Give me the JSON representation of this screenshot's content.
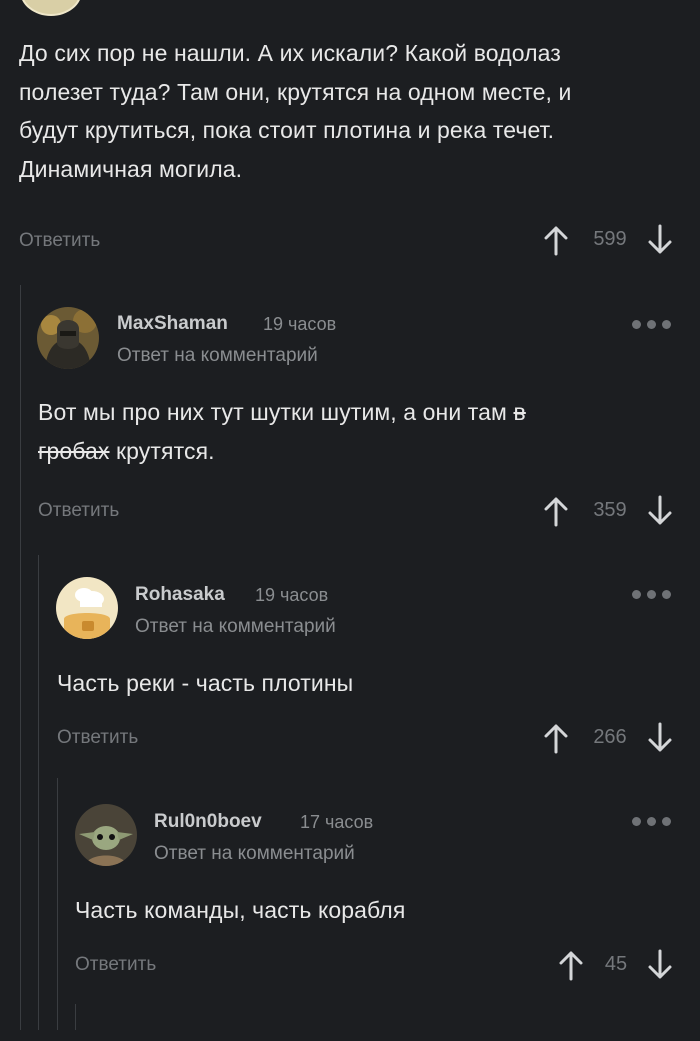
{
  "comments": [
    {
      "text_lines": [
        "До сих пор не нашли. А их искали? Какой водолаз",
        "полезет туда? Там они, крутятся на одном месте, и",
        "будут крутиться, пока стоит плотина и река течет.",
        "Динамичная могила."
      ],
      "reply_label": "Ответить",
      "votes": "599"
    },
    {
      "username": "MaxShaman",
      "time": "19 часов",
      "subline": "Ответ на комментарий",
      "text_line1": "Вот мы про них тут шутки шутим, а они там",
      "text_strike1": "в",
      "text_strike2": "гробах",
      "text_line2_tail": "крутятся.",
      "reply_label": "Ответить",
      "votes": "359"
    },
    {
      "username": "Rohasaka",
      "time": "19 часов",
      "subline": "Ответ на комментарий",
      "text": "Часть реки - часть плотины",
      "reply_label": "Ответить",
      "votes": "266"
    },
    {
      "username": "Rul0n0boev",
      "time": "17 часов",
      "subline": "Ответ на комментарий",
      "text": "Часть команды, часть корабля",
      "reply_label": "Ответить",
      "votes": "45"
    }
  ],
  "colors": {
    "background": "#1c1e21",
    "text": "#e8e8e8",
    "muted": "#75787c",
    "thread_line": "#3a3d41"
  },
  "icons": [
    "arrow-up-icon",
    "arrow-down-icon",
    "more-dots-icon"
  ]
}
